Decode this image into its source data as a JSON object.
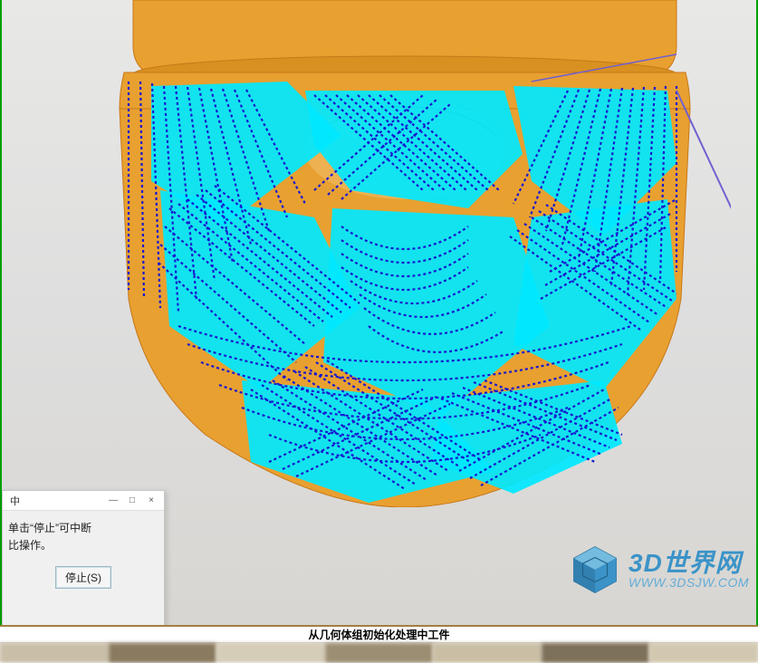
{
  "viewport": {
    "border_color": "#00a000",
    "bg_gradient_top": "#e8e8e6",
    "bg_gradient_bottom": "#d8d6d2"
  },
  "model": {
    "body_color": "#e8a030",
    "body_shadow": "#c87818",
    "surface_color": "#00e8ff",
    "toolpath_color": "#1818d0",
    "traverse_color": "#7060d0"
  },
  "dialog": {
    "title_suffix": "中",
    "text_line1": "单击“停止”可中断",
    "text_line2": "比操作。",
    "stop_button": "停止(S)"
  },
  "statusbar": {
    "message": "从几何体组初始化处理中工件"
  },
  "watermark": {
    "title": "3D世界网",
    "url": "WWW.3DSJW.COM",
    "cube_fill": "#2a8cc7",
    "cube_edge": "#1a6a9a"
  }
}
